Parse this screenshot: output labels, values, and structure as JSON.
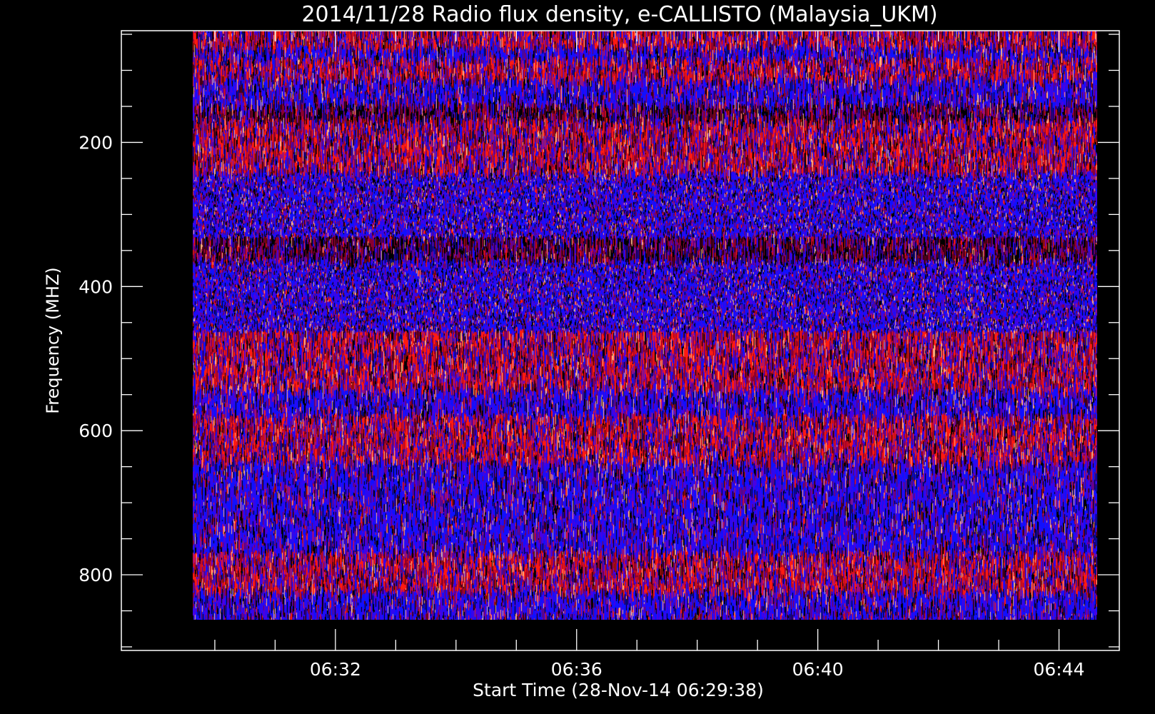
{
  "chart_data": {
    "type": "heatmap",
    "title": "2014/11/28  Radio flux density, e-CALLISTO (Malaysia_UKM)",
    "xlabel": "Start Time (28-Nov-14 06:29:38)",
    "ylabel": "Frequency (MHZ)",
    "x_tick_labels": [
      "06:32",
      "06:36",
      "06:40",
      "06:44"
    ],
    "x_tick_minutes": [
      32,
      36,
      40,
      44
    ],
    "y_tick_labels": [
      "200",
      "400",
      "600",
      "800"
    ],
    "y_tick_values": [
      200,
      400,
      600,
      800
    ],
    "xlim_minutes": [
      28.45,
      45.0
    ],
    "data_x_range_minutes": [
      29.633,
      44.633
    ],
    "ylim": [
      45,
      905
    ],
    "data_y_range": [
      45,
      862
    ],
    "y_inverted": true,
    "colormap": {
      "low": "#000000",
      "mid_low": "#1010ff",
      "mid": "#4a00e0",
      "mid_high": "#8b0030",
      "high": "#ff1a10",
      "peak": "#ffb080"
    },
    "frequency_bands": [
      {
        "from": 45,
        "to": 65,
        "level": "red"
      },
      {
        "from": 65,
        "to": 80,
        "level": "blue"
      },
      {
        "from": 80,
        "to": 110,
        "level": "red"
      },
      {
        "from": 110,
        "to": 145,
        "level": "blue"
      },
      {
        "from": 145,
        "to": 165,
        "level": "dark"
      },
      {
        "from": 165,
        "to": 240,
        "level": "red"
      },
      {
        "from": 240,
        "to": 330,
        "level": "blue"
      },
      {
        "from": 330,
        "to": 360,
        "level": "dark"
      },
      {
        "from": 360,
        "to": 460,
        "level": "blue"
      },
      {
        "from": 460,
        "to": 495,
        "level": "red"
      },
      {
        "from": 495,
        "to": 540,
        "level": "red"
      },
      {
        "from": 540,
        "to": 575,
        "level": "blue"
      },
      {
        "from": 575,
        "to": 600,
        "level": "red"
      },
      {
        "from": 600,
        "to": 640,
        "level": "red"
      },
      {
        "from": 640,
        "to": 720,
        "level": "blue"
      },
      {
        "from": 720,
        "to": 765,
        "level": "blue"
      },
      {
        "from": 765,
        "to": 820,
        "level": "red"
      },
      {
        "from": 820,
        "to": 862,
        "level": "blue"
      }
    ]
  }
}
